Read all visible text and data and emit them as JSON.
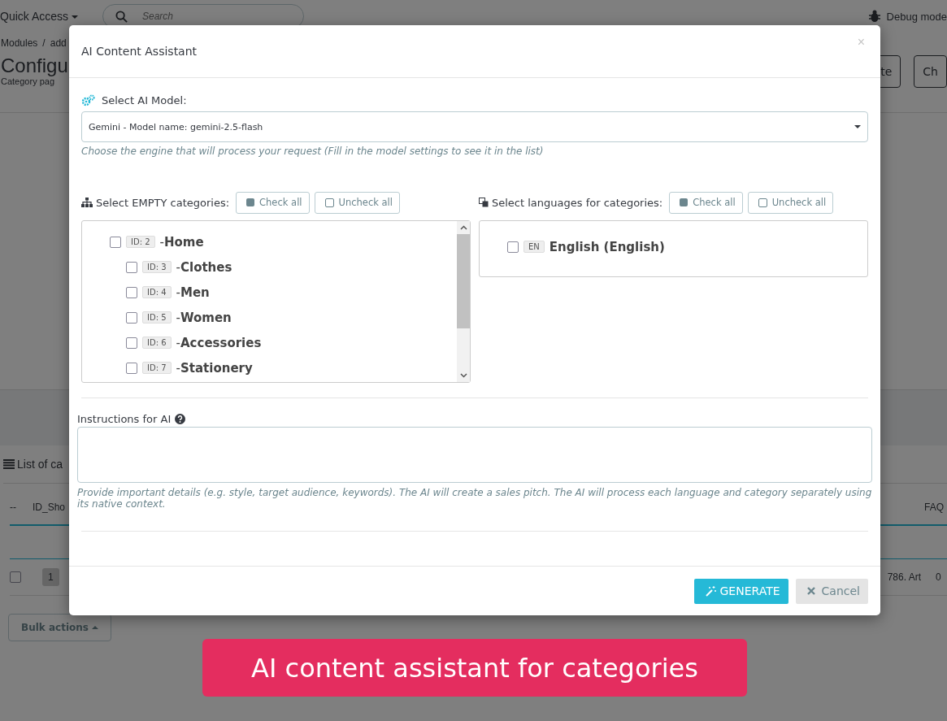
{
  "topbar": {
    "quick_access": "Quick Access",
    "search": {
      "placeholder": "Search"
    },
    "debug": "Debug mode"
  },
  "breadcrumb": {
    "items": [
      "Modules",
      "add"
    ],
    "separator": "/"
  },
  "page_header": {
    "title": "Configu",
    "subtitle": "Category pag",
    "buttons": [
      "te",
      "Ch"
    ]
  },
  "list_panel": {
    "title": "List of ca",
    "columns": [
      "--",
      "ID_Sho",
      "FAQ"
    ],
    "rows": [
      {
        "checked": false,
        "id": "1",
        "column_3": "786. Art",
        "faq": "0"
      }
    ],
    "bulk_actions": "Bulk actions"
  },
  "modal": {
    "title": "AI Content Assistant",
    "close": "×",
    "model": {
      "label": "Select AI Model:",
      "value": "Gemini - Model name: gemini-2.5-flash",
      "help": "Choose the engine that will process your request (Fill in the model settings to see it in the list)"
    },
    "categories": {
      "label": "Select EMPTY categories:",
      "check_all": "Check all",
      "uncheck_all": "Uncheck all",
      "tree": [
        {
          "id": "ID: 2",
          "name": "-**Home**",
          "checked": false,
          "children": [
            {
              "id": "ID: 3",
              "name": "-**Clothes**",
              "checked": false
            },
            {
              "id": "ID: 4",
              "name": "-**Men**",
              "checked": false
            },
            {
              "id": "ID: 5",
              "name": "-**Women**",
              "checked": false
            },
            {
              "id": "ID: 6",
              "name": "-**Accessories**",
              "checked": false
            },
            {
              "id": "ID: 7",
              "name": "-**Stationery**",
              "checked": false
            }
          ]
        }
      ]
    },
    "languages": {
      "label": "Select languages for categories:",
      "check_all": "Check all",
      "uncheck_all": "Uncheck all",
      "items": [
        {
          "code": "EN",
          "name": "English (English)",
          "checked": false
        }
      ]
    },
    "instructions": {
      "label": "Instructions for AI",
      "help": "Provide important details (e.g. style, target audience, keywords). The AI will create a sales pitch. The AI will process each language and category separately using its native context."
    },
    "generate": "GENERATE",
    "cancel": "Cancel"
  },
  "banner": "AI content assistant for categories"
}
